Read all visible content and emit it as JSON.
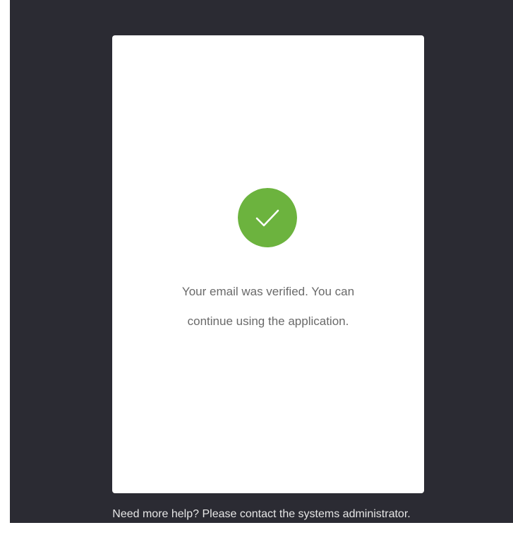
{
  "theme": {
    "background": "#2b2b33",
    "card": "#ffffff",
    "success": "#6cb33e",
    "message_text": "#6a6a6a",
    "help_text": "#e6e6e6"
  },
  "verification": {
    "icon": "check-circle-icon",
    "message_line1": "Your email was verified. You can",
    "message_line2": "continue using the application."
  },
  "footer": {
    "help_text": "Need more help? Please contact the systems administrator."
  }
}
